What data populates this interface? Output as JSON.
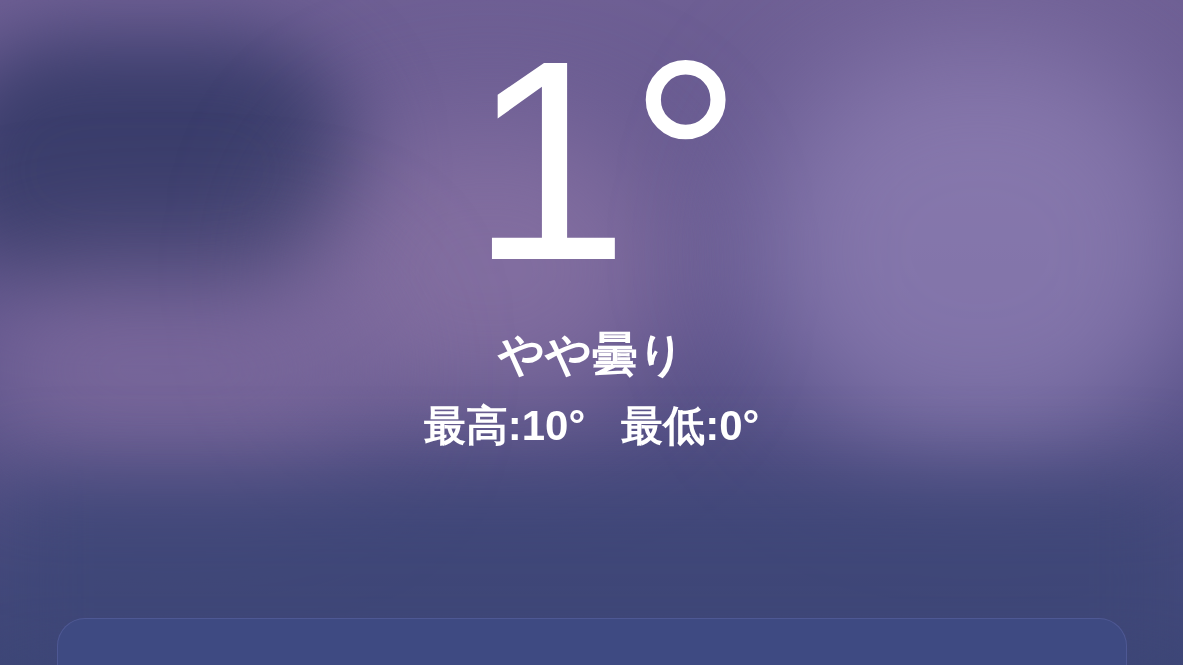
{
  "current": {
    "temperature": "1°",
    "condition": "やや曇り",
    "high": "最高:10°",
    "low": "最低:0°"
  }
}
